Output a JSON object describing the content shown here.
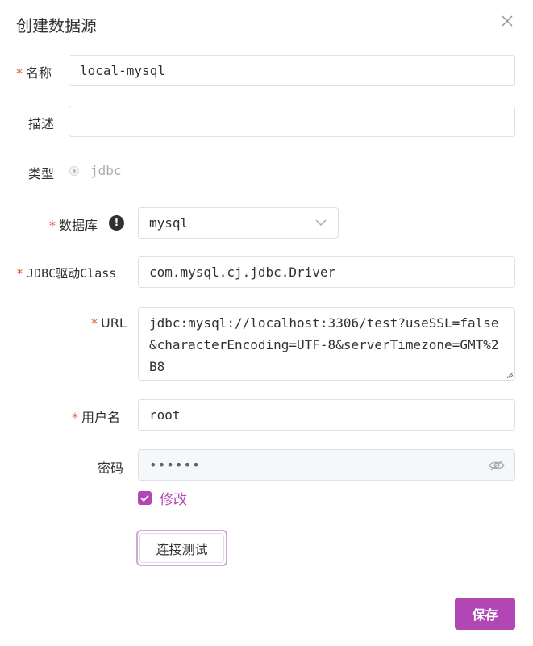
{
  "dialog": {
    "title": "创建数据源"
  },
  "form": {
    "required_mark": "*",
    "name": {
      "label": "名称",
      "value": "local-mysql"
    },
    "description": {
      "label": "描述",
      "value": ""
    },
    "type": {
      "label": "类型",
      "option": "jdbc"
    },
    "database": {
      "label": "数据库",
      "info_icon": "!",
      "value": "mysql"
    },
    "jdbc_class": {
      "label": "JDBC驱动Class",
      "value": "com.mysql.cj.jdbc.Driver"
    },
    "url": {
      "label": "URL",
      "value": "jdbc:mysql://localhost:3306/test?useSSL=false&characterEncoding=UTF-8&serverTimezone=GMT%2B8"
    },
    "username": {
      "label": "用户名",
      "value": "root"
    },
    "password": {
      "label": "密码",
      "value": "••••••"
    },
    "modify": {
      "label": "修改",
      "checked": true
    }
  },
  "buttons": {
    "test_connection": "连接测试",
    "save": "保存"
  },
  "colors": {
    "accent": "#b146b5",
    "required": "#e0552f",
    "border": "#dcdfe6"
  }
}
